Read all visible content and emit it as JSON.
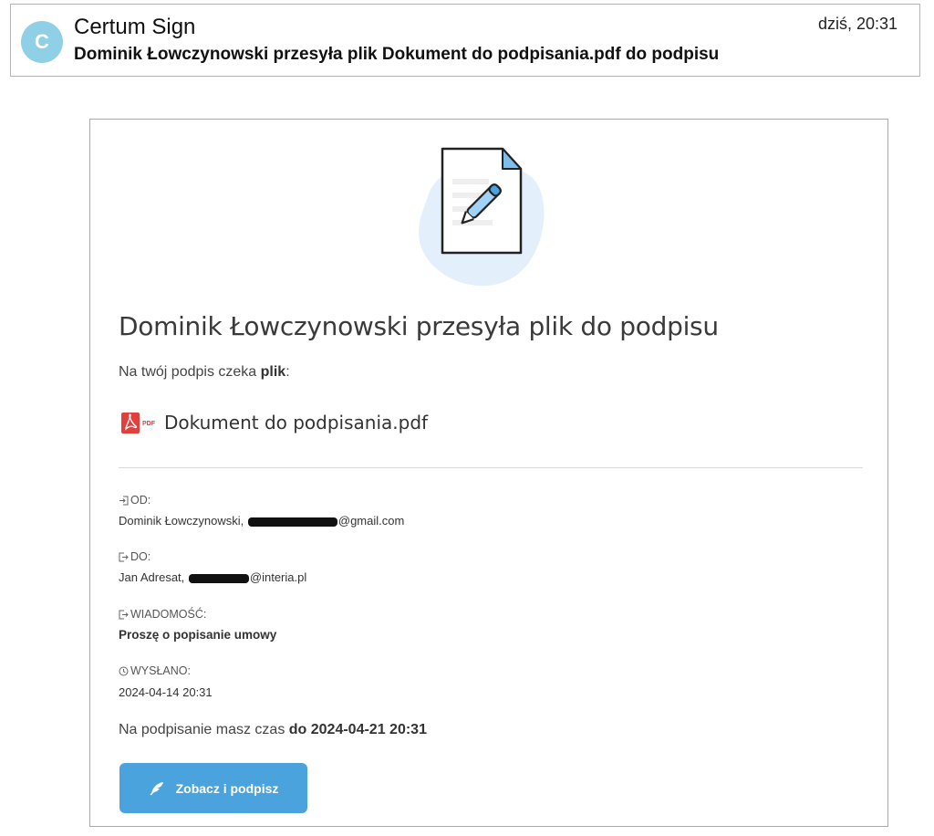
{
  "mail": {
    "avatar_letter": "C",
    "sender": "Certum Sign",
    "subject": "Dominik Łowczynowski przesyła plik Dokument do podpisania.pdf do podpisu",
    "time": "dziś, 20:31"
  },
  "email": {
    "headline": "Dominik Łowczynowski przesyła plik do podpisu",
    "waiting_prefix": "Na twój podpis czeka ",
    "waiting_bold": "plik",
    "waiting_suffix": ":",
    "file_name": "Dokument do podpisania.pdf",
    "pdf_badge": "PDF",
    "from": {
      "label": "OD:",
      "name": "Dominik Łowczynowski, ",
      "email_domain": "@gmail.com"
    },
    "to": {
      "label": "DO:",
      "name": "Jan Adresat, ",
      "email_domain": "@interia.pl"
    },
    "message": {
      "label": "WIADOMOŚĆ:",
      "value": "Proszę o popisanie umowy"
    },
    "sent": {
      "label": "WYSŁANO:",
      "value": "2024-04-14 20:31"
    },
    "deadline_prefix": "Na podpisanie masz czas ",
    "deadline_bold": "do 2024-04-21 20:31",
    "button_label": "Zobacz i podpisz"
  },
  "colors": {
    "avatar": "#8fd0e6",
    "button": "#4ba3de",
    "pdf_red": "#e2403c",
    "blob": "#e3f0fb"
  },
  "icons": [
    "document-pen-icon",
    "pdf-icon",
    "login-icon",
    "logout-icon",
    "clock-icon",
    "feather-icon"
  ]
}
